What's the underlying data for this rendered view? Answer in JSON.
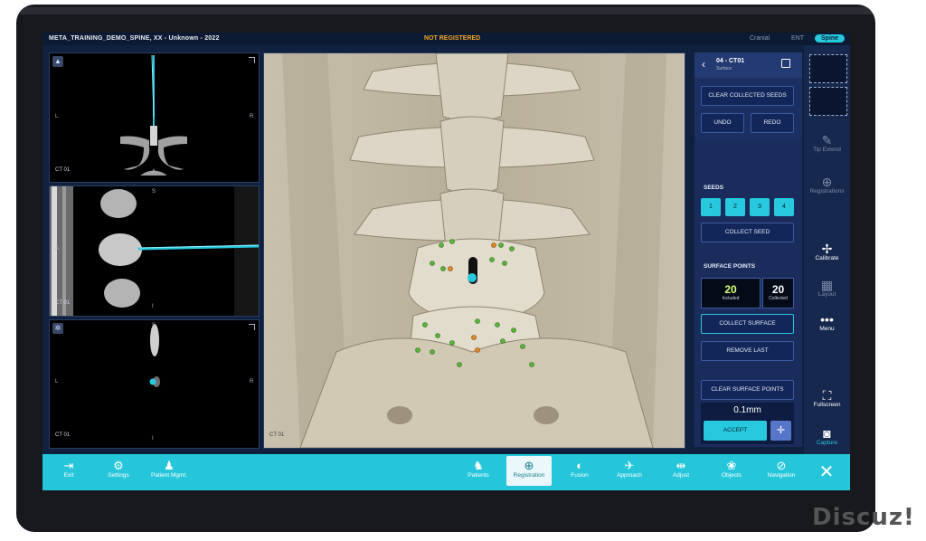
{
  "topbar": {
    "title": "META_TRAINING_DEMO_SPINE, XX - Unknown - 2022",
    "status": "NOT REGISTERED",
    "modes": [
      "Cranial",
      "ENT",
      "Spine"
    ]
  },
  "viewports": {
    "axial": {
      "label": "CT 01",
      "left": "L",
      "right": "R",
      "bottom": "A"
    },
    "sagittal": {
      "label": "CT 01",
      "top": "S",
      "left": "A",
      "bottom": "I"
    },
    "coronal": {
      "label": "CT 01",
      "top": "S",
      "left": "L",
      "right": "R",
      "bottom": "I"
    },
    "main3d": {
      "label": "CT 01"
    }
  },
  "panel": {
    "back": "‹",
    "title": "04 - CT01",
    "subtitle": "Surface",
    "clear_collected_seeds": "CLEAR COLLECTED SEEDS",
    "undo": "UNDO",
    "redo": "REDO",
    "seeds_heading": "SEEDS",
    "seeds": [
      "1",
      "2",
      "3",
      "4"
    ],
    "collect_seed": "COLLECT SEED",
    "surface_points_heading": "SURFACE POINTS",
    "included_value": "20",
    "included_label": "Included",
    "collected_value": "20",
    "collected_label": "Collected",
    "collect_surface": "COLLECT SURFACE",
    "remove_last": "REMOVE LAST",
    "clear_surface_points": "CLEAR SURFACE POINTS",
    "distance": "0.1mm",
    "accept": "ACCEPT"
  },
  "right_sidebar": {
    "tip_extend": "Tip Extend",
    "registrations": "Registrations",
    "calibrate": "Calibrate",
    "layout": "Layout",
    "menu": "Menu",
    "fullscreen": "Fullscreen",
    "capture": "Capture"
  },
  "bottombar": {
    "exit": "Exit",
    "settings": "Settings",
    "patient_mgmt": "Patient Mgmt.",
    "patients": "Patients",
    "registration": "Registration",
    "fusion": "Fusion",
    "approach": "Approach",
    "adjust": "Adjust",
    "objects": "Objects",
    "navigation": "Navigation",
    "close": "✕"
  },
  "watermark": "Discuz!",
  "colors": {
    "accent": "#27c9de",
    "status": "#f5a623",
    "panel": "#1c2f62",
    "bar": "#26c6da"
  }
}
